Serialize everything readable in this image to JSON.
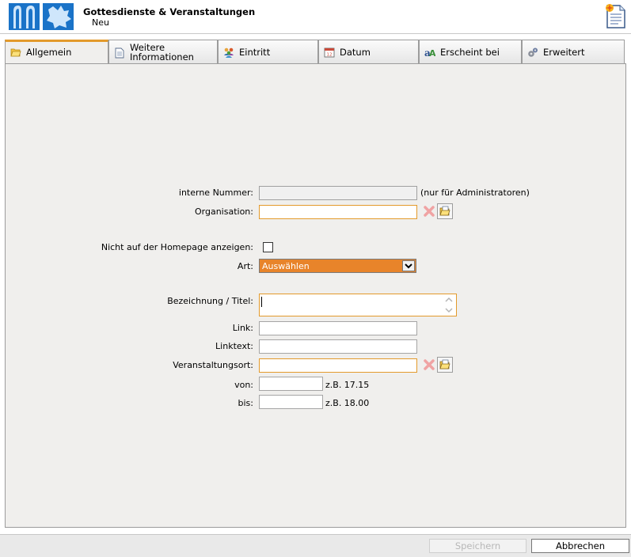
{
  "header": {
    "title": "Gottesdienste & Veranstaltungen",
    "subtitle": "Neu"
  },
  "tabs": [
    {
      "label": "Allgemein",
      "icon": "folder-icon",
      "active": true
    },
    {
      "label": "Weitere Informationen",
      "icon": "document-icon",
      "active": false
    },
    {
      "label": "Eintritt",
      "icon": "people-icon",
      "active": false
    },
    {
      "label": "Datum",
      "icon": "calendar-icon",
      "active": false
    },
    {
      "label": "Erscheint bei",
      "icon": "font-icon",
      "active": false
    },
    {
      "label": "Erweitert",
      "icon": "gears-icon",
      "active": false
    }
  ],
  "form": {
    "interne_nummer": {
      "label": "interne Nummer:",
      "value": "",
      "hint": "(nur für Administratoren)"
    },
    "organisation": {
      "label": "Organisation:",
      "value": ""
    },
    "nicht_homepage": {
      "label": "Nicht auf der Homepage anzeigen:",
      "checked": false
    },
    "art": {
      "label": "Art:",
      "selected": "Auswählen"
    },
    "bezeichnung": {
      "label": "Bezeichnung / Titel:",
      "value": ""
    },
    "link": {
      "label": "Link:",
      "value": ""
    },
    "linktext": {
      "label": "Linktext:",
      "value": ""
    },
    "veranstaltungsort": {
      "label": "Veranstaltungsort:",
      "value": ""
    },
    "von": {
      "label": "von:",
      "value": "",
      "hint": "z.B. 17.15"
    },
    "bis": {
      "label": "bis:",
      "value": "",
      "hint": "z.B. 18.00"
    }
  },
  "footer": {
    "save_label": "Speichern",
    "cancel_label": "Abbrechen"
  },
  "colors": {
    "accent": "#e39a2b",
    "select_bg": "#e8842a",
    "panel_bg": "#f0efed"
  }
}
